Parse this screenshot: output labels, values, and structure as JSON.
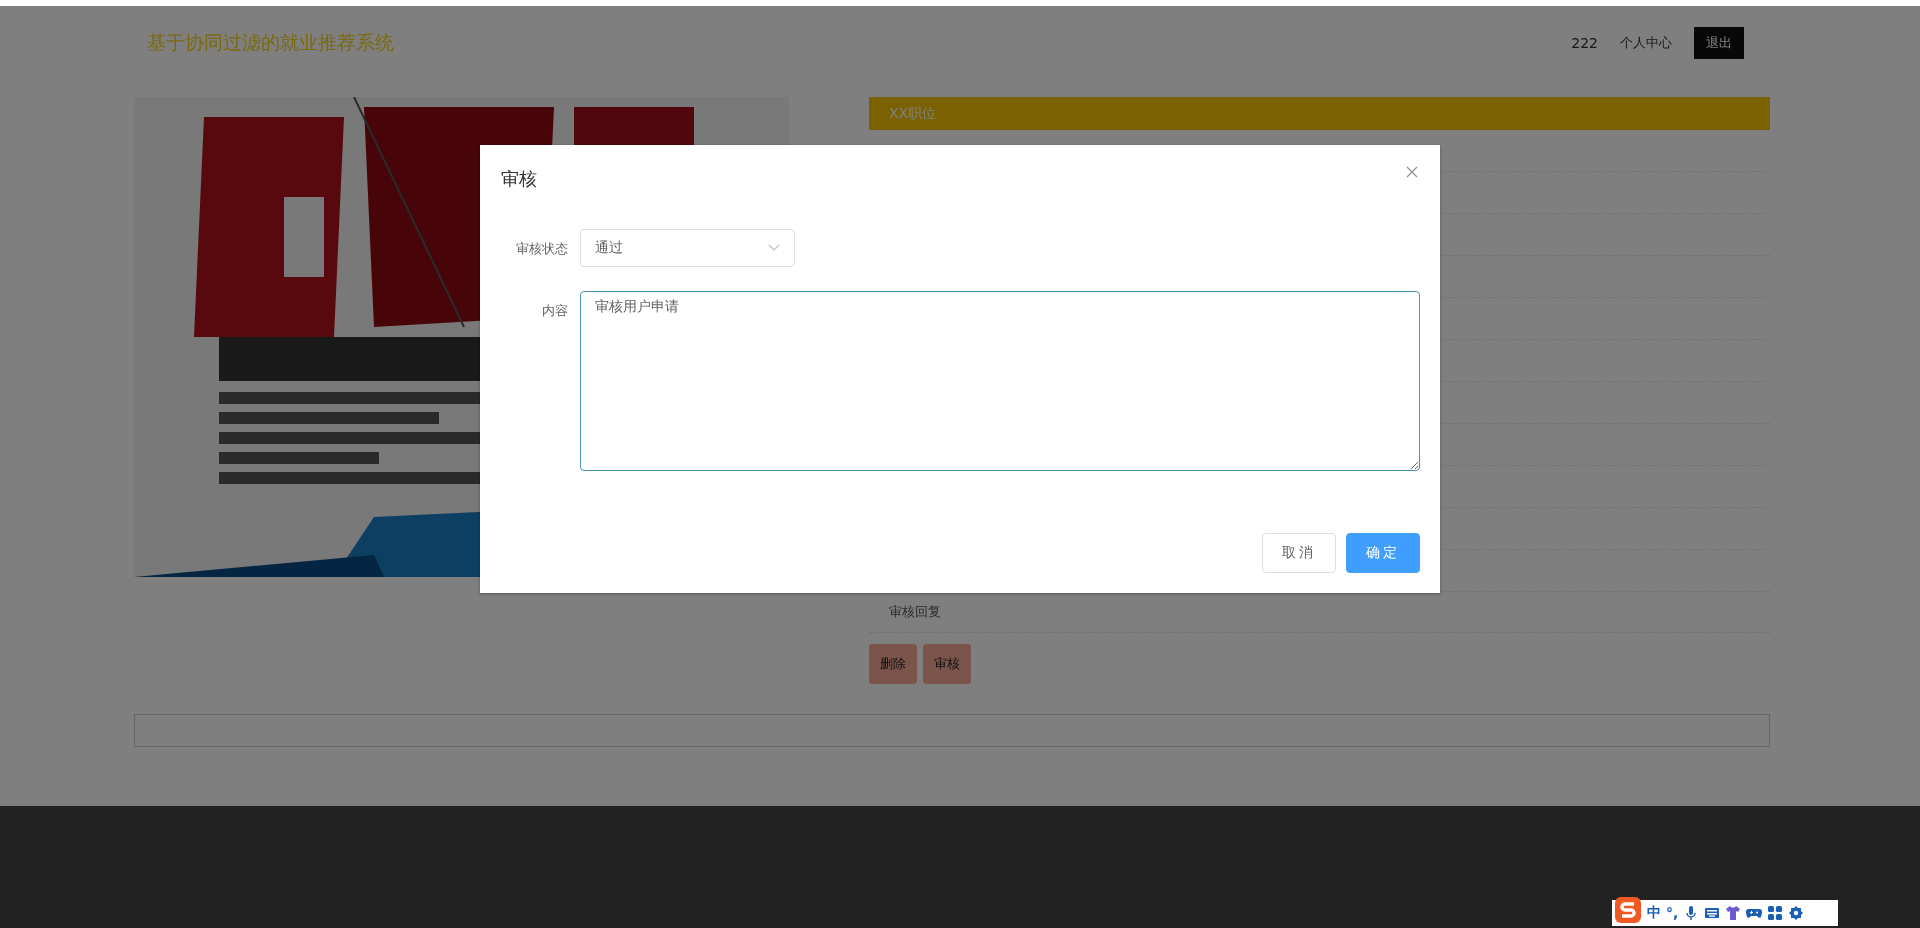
{
  "header": {
    "title": "基于协同过滤的就业推荐系统",
    "username": "222",
    "nav_link": "个人中心",
    "logout": "退出"
  },
  "job_panel": {
    "title": "XX职位",
    "reply_label": "审核回复",
    "buttons": [
      "删除",
      "审核"
    ]
  },
  "dialog": {
    "title": "审核",
    "fields": [
      {
        "kind": "select",
        "label": "审核状态",
        "value": "通过"
      },
      {
        "kind": "textarea",
        "label": "内容",
        "value": "审核用户申请"
      }
    ],
    "buttons": [
      {
        "label": "取消",
        "kind": "default"
      },
      {
        "label": "确定",
        "kind": "primary"
      }
    ]
  },
  "ime_toolbar": {
    "mode": "中",
    "punctuation": "°,"
  }
}
